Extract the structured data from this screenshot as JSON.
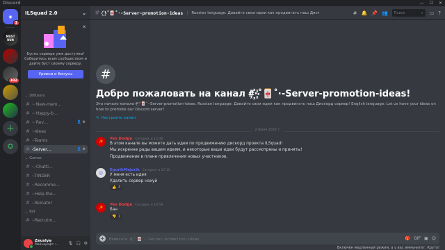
{
  "window": {
    "app_title": "Discord"
  },
  "rail": {
    "home_badge": "1",
    "server_badge": "102",
    "s1_text": "MUST RUN"
  },
  "guild": {
    "name": "ILSquad 2.0"
  },
  "boost": {
    "text": "Бусты сервера уже доступны! Соберитесь всем сообществом и дайте буст своему серверу.",
    "button": "Уровни и бонусы"
  },
  "categories": {
    "c1": "Diffusers",
    "c2": "Games",
    "c3": "Bot"
  },
  "channels": [
    {
      "label": "⋅-·New-mem…"
    },
    {
      "label": "⋅-·Happy-b…"
    },
    {
      "label": "⋅-·Rev…"
    },
    {
      "label": "⋅-Ideas"
    },
    {
      "label": "⋅-Teams"
    },
    {
      "label": "-Server…"
    },
    {
      "label": "⋅-·Chatti…"
    },
    {
      "label": "⋅-TINDER"
    },
    {
      "label": "⋅-Recomme…"
    },
    {
      "label": "⋅-Help-the…"
    },
    {
      "label": "⋅-Akinator"
    },
    {
      "label": "⋅-Recrutm…"
    }
  ],
  "user": {
    "name": "Zeuslya",
    "status": "Майнкрафт :..."
  },
  "channel": {
    "name": "꙰⋅˚🀄˚⋅-Server-promotion-ideas",
    "topic": "Russian language: Давайте свои идеи как продвигать наш Дискорд сервер!"
  },
  "search": {
    "placeholder": "Поиск"
  },
  "welcome": {
    "title": "Добро пожаловать на канал #꙰⋅˚🀄˚⋅-Server-promotion-ideas!",
    "desc": "Это начало канала #꙰⋅˚🀄˚⋅-Server-promotion-ideas. Russian language: Давайте свои идеи как продвигать наш Дискорд сервер! English language: Let us have your ideas on how to promote our Discord server!",
    "settings_link": "Настроить канал"
  },
  "date_divider": "2 июня 2022 г.",
  "messages": [
    {
      "author": "Yes Dodge",
      "time": "Сегодня, в 13:39",
      "lines": [
        "В этом канале вы можете дать идеи по продвижению дискорд проекта ILSquad!",
        "Мы искренне рады вашим идеям, и некоторые ваши идеи будут рассмотрены и приняты!",
        "Продвижение в плане привлечения новых участников."
      ]
    },
    {
      "author": "EgorikMajorik",
      "time": "Сегодня, в 17:11",
      "lines": [
        "У меня есть идея",
        "Удалить сервер нахуй"
      ],
      "reaction_emoji": "👍",
      "reaction_count": "3"
    },
    {
      "author": "Yes Dodge",
      "time": "Сегодня, в 19:59",
      "lines": [
        "бан"
      ],
      "reaction_emoji": "👎",
      "reaction_count": "1"
    }
  ],
  "composer": {
    "placeholder": "Написать #꙰⋅˚🀄˚⋅-Server-promotion-ideas"
  },
  "slowmode": "Включён медленный режим, а у вас иммунитет. Круто!",
  "colors": {
    "blurple": "#5865f2",
    "red": "#ed4245",
    "green": "#3ba55c"
  }
}
